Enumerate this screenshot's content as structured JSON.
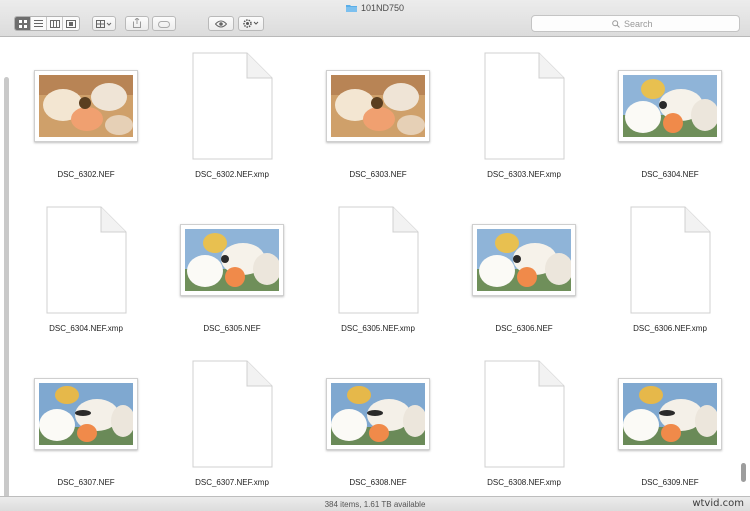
{
  "window": {
    "title": "101ND750"
  },
  "toolbar": {
    "view_modes": [
      {
        "icon": "icon-view-icon",
        "active": true
      },
      {
        "icon": "list-view-icon",
        "active": false
      },
      {
        "icon": "column-view-icon",
        "active": false
      },
      {
        "icon": "cover-flow-icon",
        "active": false
      }
    ],
    "arrange_icon": "arrange-icon",
    "share_icon": "share-icon",
    "tag_icon": "tag-icon",
    "quicklook_icon": "eye-icon",
    "action_icon": "gear-icon"
  },
  "search": {
    "placeholder": "Search",
    "icon": "search-icon"
  },
  "files": [
    {
      "name": "DSC_6302.NEF",
      "kind": "photo",
      "variant": "a"
    },
    {
      "name": "DSC_6302.NEF.xmp",
      "kind": "doc"
    },
    {
      "name": "DSC_6303.NEF",
      "kind": "photo",
      "variant": "a"
    },
    {
      "name": "DSC_6303.NEF.xmp",
      "kind": "doc"
    },
    {
      "name": "DSC_6304.NEF",
      "kind": "photo",
      "variant": "b"
    },
    {
      "name": "DSC_6304.NEF.xmp",
      "kind": "doc"
    },
    {
      "name": "DSC_6305.NEF",
      "kind": "photo",
      "variant": "b"
    },
    {
      "name": "DSC_6305.NEF.xmp",
      "kind": "doc"
    },
    {
      "name": "DSC_6306.NEF",
      "kind": "photo",
      "variant": "b"
    },
    {
      "name": "DSC_6306.NEF.xmp",
      "kind": "doc"
    },
    {
      "name": "DSC_6307.NEF",
      "kind": "photo",
      "variant": "c"
    },
    {
      "name": "DSC_6307.NEF.xmp",
      "kind": "doc"
    },
    {
      "name": "DSC_6308.NEF",
      "kind": "photo",
      "variant": "c"
    },
    {
      "name": "DSC_6308.NEF.xmp",
      "kind": "doc"
    },
    {
      "name": "DSC_6309.NEF",
      "kind": "photo",
      "variant": "c"
    }
  ],
  "status": {
    "text": "384 items, 1.61 TB available"
  },
  "watermark": {
    "text": "wtvid.com"
  },
  "colors": {
    "folder": "#5aaee8",
    "active_view": "#6e6e6e"
  }
}
